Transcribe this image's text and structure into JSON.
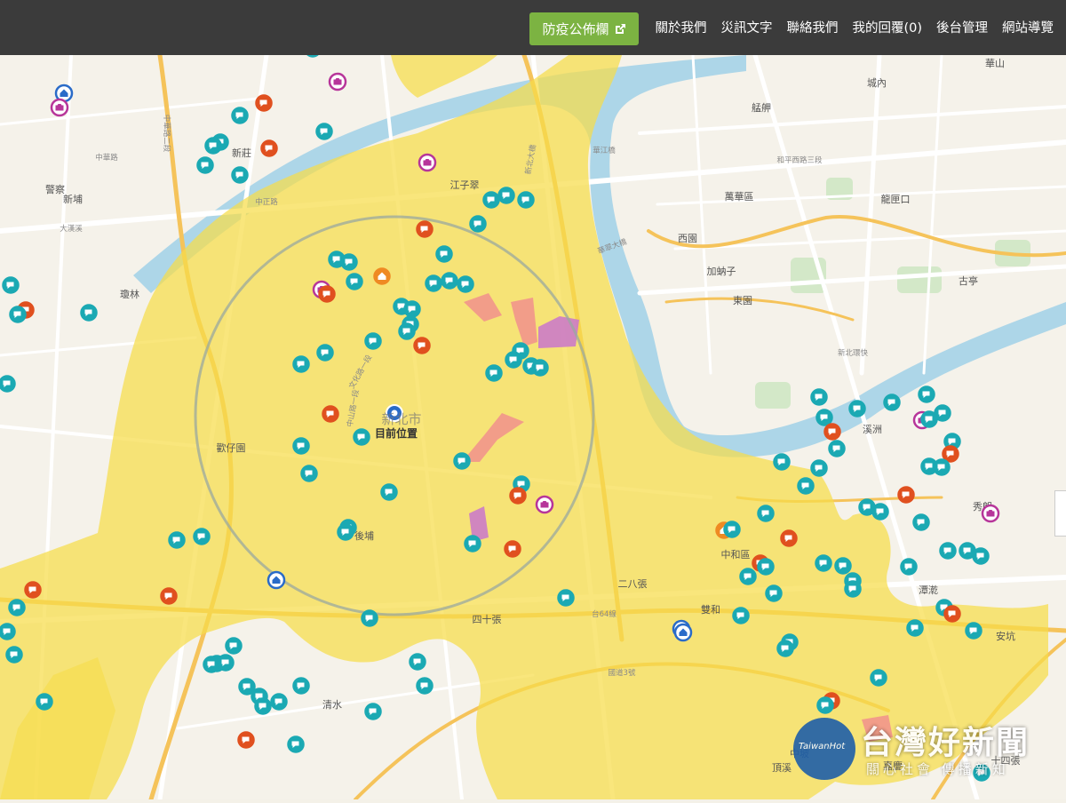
{
  "nav": {
    "announce_label": "防疫公佈欄",
    "announce_icon": "external-link-icon",
    "links": [
      "關於我們",
      "災訊文字",
      "聯絡我們",
      "我的回覆(0)",
      "後台管理",
      "網站導覽"
    ]
  },
  "map": {
    "current_location_label": "目前位置",
    "center_district_label": "新北市",
    "district_labels": [
      "華山",
      "城內",
      "艋舺",
      "龍匣口",
      "萬華區",
      "西園",
      "加蚋子",
      "東園",
      "古亭",
      "江子翠",
      "新莊",
      "新埔",
      "瓊林",
      "歡仔園",
      "中和區",
      "溪洲",
      "秀朗",
      "潭漧",
      "清水",
      "後埔",
      "四十張",
      "二八張",
      "雙和",
      "嘉慶",
      "中坡",
      "警察",
      "頂溪",
      "安坑",
      "十四張"
    ],
    "road_labels": [
      "新北大橋",
      "華江橋",
      "華翠大橋",
      "和平西路三段",
      "中華路",
      "大漢溪",
      "中正路",
      "新北環快",
      "台64線",
      "國道3號",
      "中山路一段",
      "文化路一段",
      "中華路二段"
    ],
    "colors": {
      "zone_fill": "#f7dc4a",
      "river": "#a9d4e8",
      "park": "#cfe6c4",
      "icon_teal": "#1ba9b3",
      "icon_red": "#e0501f",
      "icon_magenta": "#b7359a",
      "icon_blue": "#2a6bc8",
      "icon_orange": "#ef8a23",
      "zone_pink": "#f2958c",
      "zone_purple": "#cc7bc8"
    },
    "marker_icon_names": [
      "chat-bubble-icon",
      "camera-icon",
      "house-icon",
      "location-icon"
    ]
  },
  "watermark": {
    "logo_text": "TaiwanHot",
    "title": "台灣好新聞",
    "subtitle": "關心社會 傳播新知"
  }
}
